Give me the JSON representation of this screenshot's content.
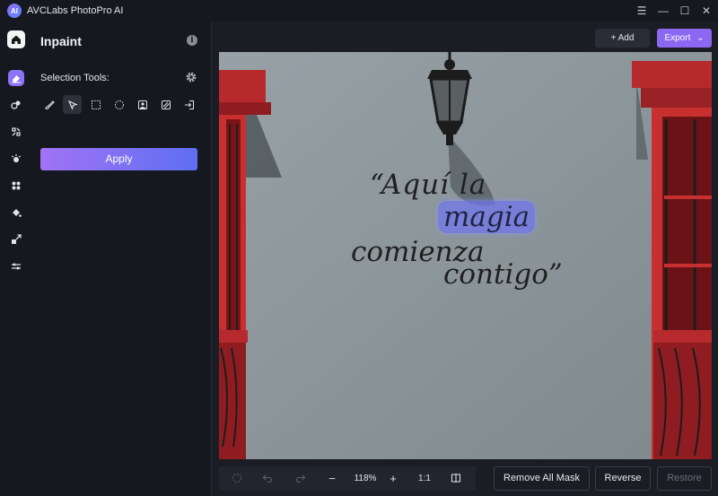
{
  "app": {
    "title": "AVCLabs PhotoPro AI",
    "logo_text": "AI"
  },
  "window_controls": {
    "menu": "☰",
    "minimize": "—",
    "maximize": "☐",
    "close": "✕"
  },
  "rail": {
    "items": [
      {
        "name": "home-icon"
      },
      {
        "name": "inpaint-eraser-icon",
        "active": true
      },
      {
        "name": "colorize-icon"
      },
      {
        "name": "enhance-icon"
      },
      {
        "name": "effects-icon"
      },
      {
        "name": "ai-tool-icon"
      },
      {
        "name": "fill-icon"
      },
      {
        "name": "resize-icon"
      },
      {
        "name": "adjust-icon"
      }
    ]
  },
  "panel": {
    "title": "Inpaint",
    "info": "i",
    "selection_label": "Selection Tools:",
    "apply_label": "Apply",
    "tools": [
      "brush-icon",
      "lasso-pointer-icon",
      "rect-select-icon",
      "ellipse-select-icon",
      "portrait-select-icon",
      "pattern-select-icon",
      "import-mask-icon"
    ],
    "active_tool": 1
  },
  "toolbar": {
    "add_label": "+ Add",
    "export_label": "Export",
    "export_chevron": "⌄"
  },
  "canvas": {
    "text_line1": "“Aquí la",
    "text_highlight": "magia",
    "text_line2": "comienza",
    "text_line3": "contigo”"
  },
  "bottom": {
    "zoom_level": "118%",
    "zoom_out": "−",
    "zoom_in": "+",
    "fit_label": "1:1",
    "remove_all_mask": "Remove All Mask",
    "reverse": "Reverse",
    "restore": "Restore"
  },
  "colors": {
    "accent": "#8b67f2",
    "apply_start": "#a273f5",
    "apply_end": "#5e6ff2",
    "wall": "#8c969a",
    "shutter": "#b8262a"
  }
}
